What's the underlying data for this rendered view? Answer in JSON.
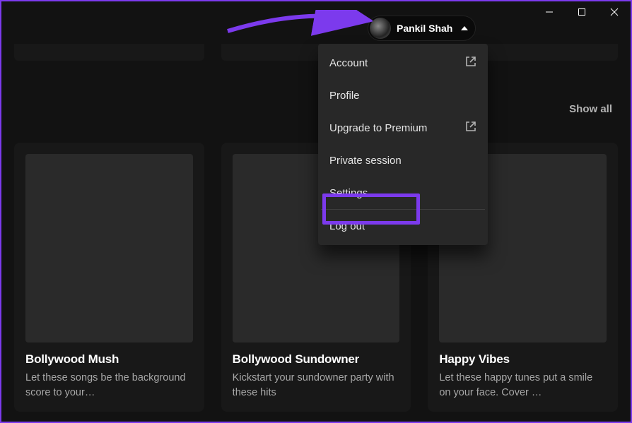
{
  "user": {
    "name": "Pankil Shah"
  },
  "menu": {
    "account": "Account",
    "profile": "Profile",
    "upgrade": "Upgrade to Premium",
    "private": "Private session",
    "settings": "Settings",
    "logout": "Log out"
  },
  "showAll": "Show all",
  "cards": [
    {
      "title": "Bollywood Mush",
      "desc": "Let these songs be the background score to your…"
    },
    {
      "title": "Bollywood Sundowner",
      "desc": "Kickstart your sundowner party with these hits"
    },
    {
      "title": "Happy Vibes",
      "desc": "Let these happy tunes put a smile on your face. Cover …"
    }
  ]
}
